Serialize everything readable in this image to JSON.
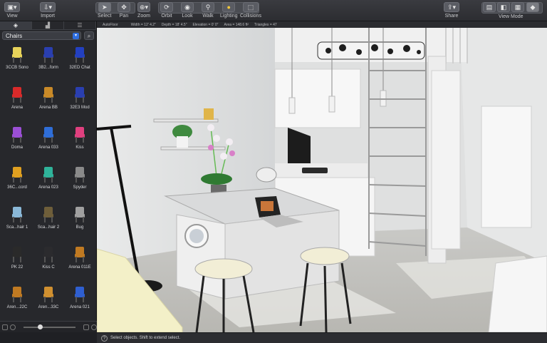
{
  "toolbar": {
    "left": [
      {
        "label": "View",
        "icon": "view-icon"
      },
      {
        "label": "Import",
        "icon": "import-icon"
      }
    ],
    "tools": [
      {
        "label": "Select",
        "icon": "cursor-icon"
      },
      {
        "label": "Pan",
        "icon": "pan-icon"
      },
      {
        "label": "Zoom",
        "icon": "zoom-icon"
      },
      {
        "label": "Orbit",
        "icon": "orbit-icon"
      },
      {
        "label": "Look",
        "icon": "eye-icon"
      },
      {
        "label": "Walk",
        "icon": "walk-icon"
      },
      {
        "label": "Lighting",
        "icon": "bulb-icon"
      },
      {
        "label": "Collisions",
        "icon": "collisions-icon"
      }
    ],
    "share_label": "Share",
    "view_mode_label": "View Mode"
  },
  "infobar": {
    "mode": "AutoFloor",
    "width": "Width = 12' 4.2\"",
    "depth": "Depth = 18' 4.5\"",
    "elevation": "Elevation = 0' 0\"",
    "area": "Area = 148.6 ft²",
    "triangles": "Triangles = 47"
  },
  "sidebar": {
    "category": "Chairs",
    "items": [
      {
        "name": "3CCB Sono",
        "color": "#e8d35a"
      },
      {
        "name": "3B2...form",
        "color": "#2a3fb0"
      },
      {
        "name": "32ED Chat",
        "color": "#2340c0"
      },
      {
        "name": "Arena",
        "color": "#d92a2a"
      },
      {
        "name": "Arena BB",
        "color": "#c98a28"
      },
      {
        "name": "32E3 Mod",
        "color": "#2a3fb0"
      },
      {
        "name": "Doma",
        "color": "#9b4fd6"
      },
      {
        "name": "Arena 033",
        "color": "#2f6ed8"
      },
      {
        "name": "Kiss",
        "color": "#e0407f"
      },
      {
        "name": "36C...cord",
        "color": "#e0a020"
      },
      {
        "name": "Arena 023",
        "color": "#2fb39a"
      },
      {
        "name": "Spyder",
        "color": "#8a8a8a"
      },
      {
        "name": "Sca...hair 1",
        "color": "#8ab8d8"
      },
      {
        "name": "Sca...hair 2",
        "color": "#6e5e3a"
      },
      {
        "name": "Bug",
        "color": "#a0a0a0"
      },
      {
        "name": "PK 22",
        "color": "#2a2a2a"
      },
      {
        "name": "Kiss C",
        "color": "#2b2b2e"
      },
      {
        "name": "Arena 011E",
        "color": "#c07a22"
      },
      {
        "name": "Aren...22C",
        "color": "#c07a22"
      },
      {
        "name": "Aren...33C",
        "color": "#d09030"
      },
      {
        "name": "Arena 021",
        "color": "#2f5fd0"
      }
    ]
  },
  "status": {
    "hint": "Select objects. Shift to extend select."
  }
}
